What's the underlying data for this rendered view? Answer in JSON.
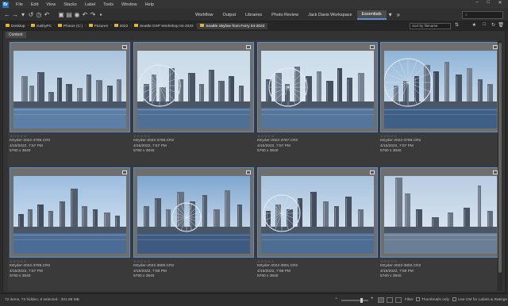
{
  "menubar": {
    "app_badge": "Br",
    "items": [
      "File",
      "Edit",
      "View",
      "Stacks",
      "Label",
      "Tools",
      "Window",
      "Help"
    ],
    "window_controls": [
      "–",
      "□",
      "✕"
    ]
  },
  "toolbar": {
    "workspaces": [
      "Workflow",
      "Output",
      "Libraries",
      "Photo Review",
      "Jack Davis Workspace",
      "Essentials"
    ],
    "active_workspace": "Essentials",
    "search_placeholder": "⌕"
  },
  "pathbar": {
    "crumbs": [
      "Desktop",
      "KathyPC",
      "Photos (C:)",
      "Pictures",
      "2022",
      "Seattle DSP Workshop 04-2022"
    ],
    "current": "Seattle Skyline from Ferry 04-2022",
    "sort_label": "Sort by filename"
  },
  "panel": {
    "tab_label": "Content"
  },
  "thumbnails": [
    {
      "stars": "☆☆☆☆☆",
      "filename": "KEyder-2022-3795.CR2",
      "date": "4/15/2022, 7:57 PM",
      "dims": "5760 x 3840",
      "sky": "#a9c4dd",
      "water": "#5b7fa6"
    },
    {
      "stars": "☆☆☆☆☆",
      "filename": "KEyder-2022-3796.CR2",
      "date": "4/15/2022, 7:57 PM",
      "dims": "5760 x 3840",
      "sky": "#c7d9e8",
      "water": "#4f6f95"
    },
    {
      "stars": "☆☆☆☆☆",
      "filename": "KEyder-2022-3797.CR2",
      "date": "4/15/2022, 7:57 PM",
      "dims": "5760 x 3840",
      "sky": "#c9dbea",
      "water": "#56759b"
    },
    {
      "stars": "☆☆☆☆☆",
      "filename": "KEyder-2022-3798.CR2",
      "date": "4/15/2022, 7:57 PM",
      "dims": "5760 x 3840",
      "sky": "#8fb4d8",
      "water": "#3f5f86"
    },
    {
      "stars": "☆☆☆☆☆",
      "filename": "KEyder-2022-3799.CR2",
      "date": "4/15/2022, 7:57 PM",
      "dims": "5760 x 3840",
      "sky": "#9bbde0",
      "water": "#4a6c95"
    },
    {
      "stars": "☆☆☆☆☆",
      "filename": "KEyder-2022-3800.CR2",
      "date": "4/15/2022, 7:58 PM",
      "dims": "5760 x 3840",
      "sky": "#7ea6d0",
      "water": "#3e5a80"
    },
    {
      "stars": "☆☆☆☆☆",
      "filename": "KEyder-2022-3801.CR2",
      "date": "4/15/2022, 7:58 PM",
      "dims": "5760 x 3840",
      "sky": "#a6c2de",
      "water": "#4d6d93"
    },
    {
      "stars": "☆☆☆☆☆",
      "filename": "KEyder-2022-3802.CR2",
      "date": "4/15/2022, 7:59 PM",
      "dims": "5760 x 3840",
      "sky": "#b8cde3",
      "water": "#6a7f96"
    }
  ],
  "statusbar": {
    "status": "72 items, 72 hidden, 8 selected · 301.98 MB",
    "filter_label": "Filter",
    "thumbnails_only": "Thumbnails only",
    "use_cm": "Use CM for Labels & Ratings"
  },
  "colors": {
    "accent": "#5b8fd4",
    "folder": "#e3b23c"
  }
}
